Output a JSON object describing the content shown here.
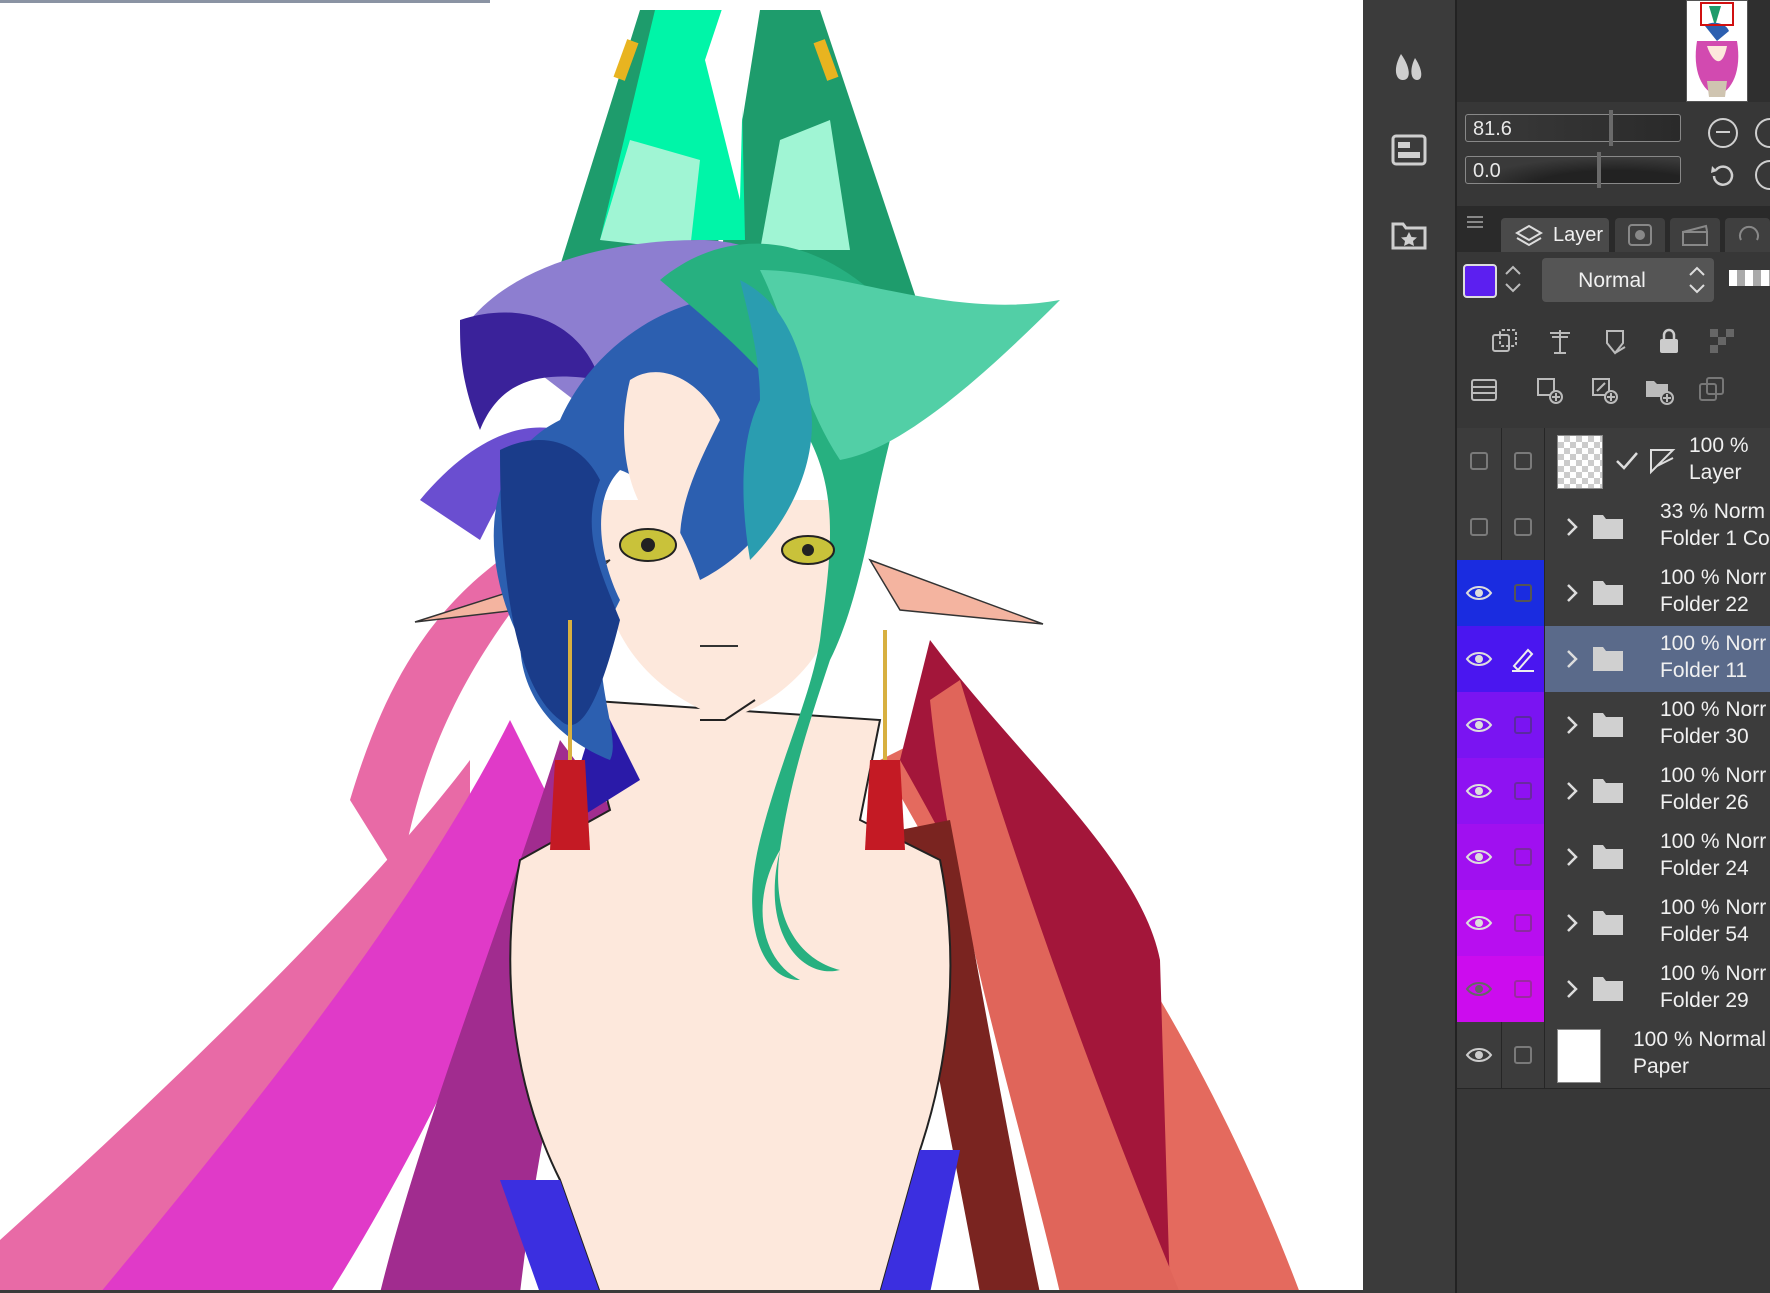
{
  "navigator": {
    "zoom_value": "81.6",
    "rotate_value": "0.0"
  },
  "layer_panel": {
    "tab_label": "Layer",
    "blend_mode": "Normal",
    "current_color": "#5c1ff0",
    "layers": [
      {
        "opacity": "100 %",
        "mode": "",
        "name": "Layer",
        "visible": false,
        "kind": "raster"
      },
      {
        "opacity": "33 %",
        "mode": "Norm",
        "name": "Folder 1 Co",
        "visible": false,
        "kind": "folder"
      },
      {
        "opacity": "100 %",
        "mode": "Norr",
        "name": "Folder 22",
        "visible": true,
        "kind": "folder",
        "color": "#1a2ce0"
      },
      {
        "opacity": "100 %",
        "mode": "Norr",
        "name": "Folder 11",
        "visible": true,
        "kind": "folder",
        "color": "#4a16f0",
        "selected": true
      },
      {
        "opacity": "100 %",
        "mode": "Norr",
        "name": "Folder 30",
        "visible": true,
        "kind": "folder",
        "color": "#7a14f2"
      },
      {
        "opacity": "100 %",
        "mode": "Norr",
        "name": "Folder 26",
        "visible": true,
        "kind": "folder",
        "color": "#8e12f2"
      },
      {
        "opacity": "100 %",
        "mode": "Norr",
        "name": "Folder 24",
        "visible": true,
        "kind": "folder",
        "color": "#a010f0"
      },
      {
        "opacity": "100 %",
        "mode": "Norr",
        "name": "Folder 54",
        "visible": true,
        "kind": "folder",
        "color": "#b80ef0"
      },
      {
        "opacity": "100 %",
        "mode": "Norr",
        "name": "Folder 29",
        "visible": true,
        "kind": "folder",
        "color": "#cc0cee"
      },
      {
        "opacity": "100 %",
        "mode": "Normal",
        "name": "Paper",
        "visible": true,
        "kind": "paper"
      }
    ]
  },
  "toolbar": {
    "icons": [
      "drops-icon",
      "layer-property-icon",
      "material-favorites-icon"
    ]
  }
}
